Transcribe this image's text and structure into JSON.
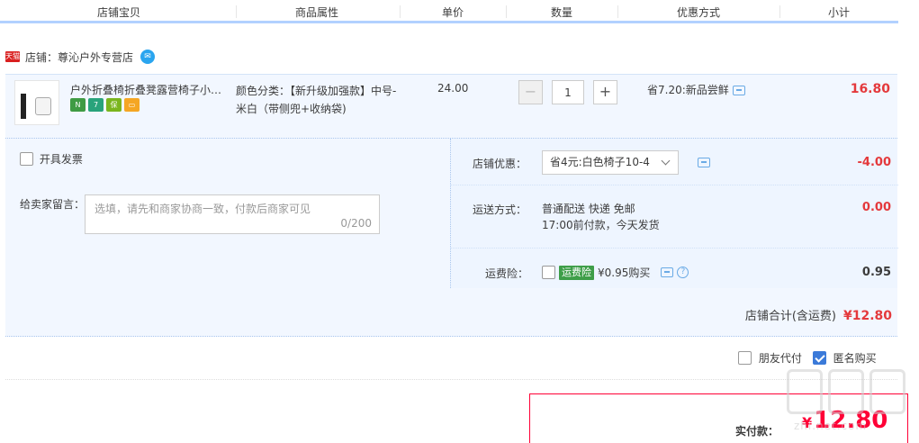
{
  "header": {
    "columns": [
      "店铺宝贝",
      "商品属性",
      "单价",
      "数量",
      "优惠方式",
      "小计"
    ]
  },
  "shop": {
    "badge": "天猫",
    "name": "店铺：尊沁户外专营店"
  },
  "item": {
    "title": "户外折叠椅折叠凳露营椅子小马扎",
    "attributes": "颜色分类：【新升级加强款】中号-米白（带侧兜+收纳袋)",
    "price": "24.00",
    "quantity": "1",
    "promotion": "省7.20:新品尝鲜",
    "subtotal": "16.80",
    "badge_colors": [
      "#3f9b44",
      "#29a37b",
      "#7ab51d",
      "#f5a623"
    ]
  },
  "order": {
    "invoice_label": "开具发票",
    "note_label": "给卖家留言：",
    "note_placeholder": "选填，请先和商家协商一致，付款后商家可见",
    "note_count": "0/200",
    "shop_discount_label": "店铺优惠：",
    "shop_discount_value": "省4元:白色椅子10-4",
    "shop_discount_amount": "-4.00",
    "shipping_label": "运送方式：",
    "shipping_line1": "普通配送 快递 免邮",
    "shipping_line2": "17:00前付款，今天发货",
    "shipping_amount": "0.00",
    "insurance_label": "运费险：",
    "insurance_tag": "运费险",
    "insurance_text": "¥0.95购买",
    "insurance_amount": "0.95",
    "total_label": "店铺合计(含运费)",
    "total_amount": "¥12.80"
  },
  "options": {
    "friend_pay": "朋友代付",
    "anonymous": "匿名购买"
  },
  "payment": {
    "label": "实付款：",
    "currency": "¥",
    "amount": "12.80"
  },
  "watermark": {
    "text": "zhi.net.com"
  }
}
